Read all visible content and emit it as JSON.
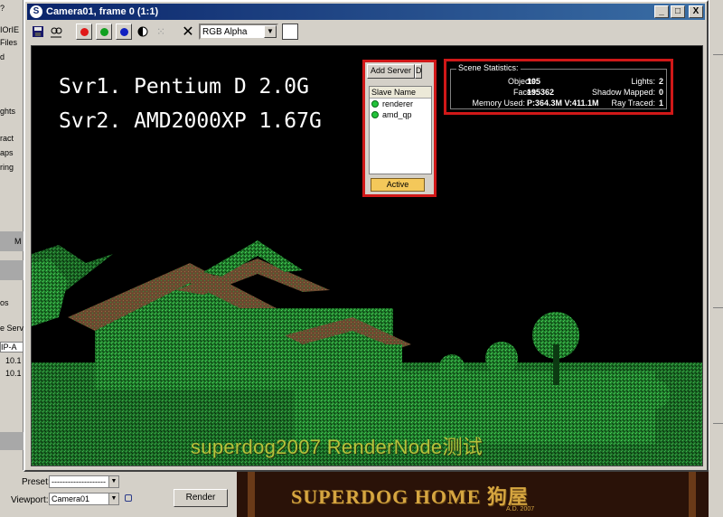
{
  "window": {
    "title": "Camera01, frame 0 (1:1)",
    "min_label": "_",
    "max_label": "□",
    "close_label": "X"
  },
  "toolbar": {
    "channel_colors": {
      "red": "#e01818",
      "green": "#10a020",
      "blue": "#1020c0"
    },
    "channel_display": "RGB Alpha",
    "clear_icon": "✕"
  },
  "overlay": {
    "line1": "Svr1. Pentium D 2.0G",
    "line2": "Svr2. AMD2000XP 1.67G",
    "caption": "superdog2007 RenderNode测试"
  },
  "slave_panel": {
    "tab_add": "Add Server",
    "tab_second": "D",
    "column_header": "Slave Name",
    "slaves": [
      {
        "name": "renderer",
        "status_color": "#22c33a"
      },
      {
        "name": "amd_qp",
        "status_color": "#22c33a"
      }
    ],
    "active_button": "Active"
  },
  "scene_stats": {
    "title": "Scene Statistics:",
    "objects_label": "Objects:",
    "objects_value": "105",
    "faces_label": "Faces:",
    "faces_value": "195362",
    "memory_label": "Memory Used:",
    "memory_value": "P:364.3M V:411.1M",
    "lights_label": "Lights:",
    "lights_value": "2",
    "shadow_label": "Shadow Mapped:",
    "shadow_value": "0",
    "raytraced_label": "Ray Traced:",
    "raytraced_value": "1"
  },
  "background_left": {
    "top_button": "?",
    "fragments": [
      "IOrIE",
      "Files",
      "d",
      "ghts",
      "ract",
      "aps",
      "ring",
      "M",
      "os",
      "e Serv",
      "IP-A",
      "10.1",
      "10.1"
    ]
  },
  "bottom": {
    "preset_label": "Preset:",
    "preset_value": "--------------------",
    "viewport_label": "Viewport:",
    "viewport_value": "Camera01",
    "render_button": "Render",
    "thumb_title": "SUPERDOG HOME 狗屋",
    "thumb_sub": "A.D. 2007"
  },
  "colors": {
    "highlight_border": "#d01818",
    "title_gradient_start": "#0a246a",
    "active_button_bg": "#f4c85a",
    "caption_color": "#b5c23b",
    "house_green": "#2ea83a"
  }
}
